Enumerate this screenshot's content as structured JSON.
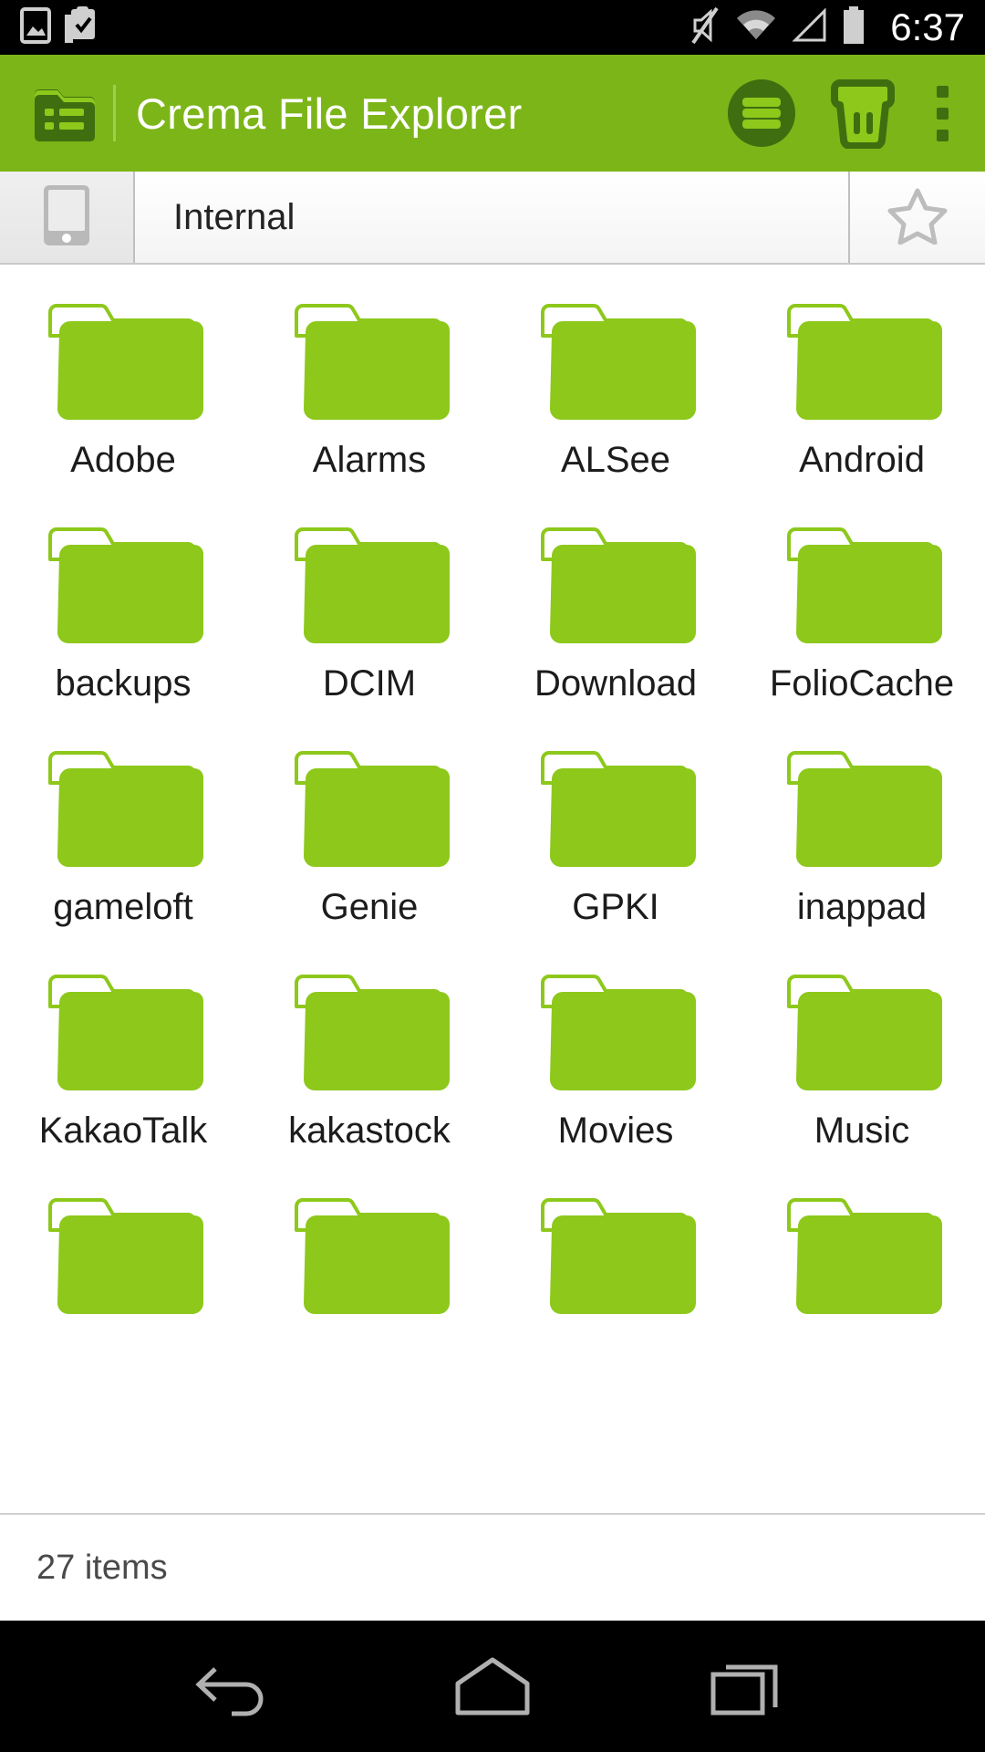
{
  "status_bar": {
    "icons": [
      "image-icon",
      "clipboard-check-icon",
      "mute-icon",
      "wifi-icon",
      "signal-icon",
      "battery-icon"
    ],
    "time": "6:37"
  },
  "action_bar": {
    "app_icon": "folder-list-icon",
    "title": "Crema File Explorer",
    "actions": [
      {
        "name": "list-view-icon",
        "label": "List view"
      },
      {
        "name": "trash-icon",
        "label": "Trash"
      },
      {
        "name": "overflow-menu-icon",
        "label": "More options"
      }
    ],
    "bg_color": "#7cb518",
    "title_color": "#ffffff"
  },
  "path_bar": {
    "device_icon": "tablet-icon",
    "path": "Internal",
    "star_icon": "star-outline-icon"
  },
  "grid": {
    "folder_color": "#8dc81b",
    "items": [
      {
        "name": "Adobe",
        "type": "folder"
      },
      {
        "name": "Alarms",
        "type": "folder"
      },
      {
        "name": "ALSee",
        "type": "folder"
      },
      {
        "name": "Android",
        "type": "folder"
      },
      {
        "name": "backups",
        "type": "folder"
      },
      {
        "name": "DCIM",
        "type": "folder"
      },
      {
        "name": "Download",
        "type": "folder"
      },
      {
        "name": "FolioCache",
        "type": "folder"
      },
      {
        "name": "gameloft",
        "type": "folder"
      },
      {
        "name": "Genie",
        "type": "folder"
      },
      {
        "name": "GPKI",
        "type": "folder"
      },
      {
        "name": "inappad",
        "type": "folder"
      },
      {
        "name": "KakaoTalk",
        "type": "folder"
      },
      {
        "name": "kakastock",
        "type": "folder"
      },
      {
        "name": "Movies",
        "type": "folder"
      },
      {
        "name": "Music",
        "type": "folder"
      },
      {
        "name": "",
        "type": "folder"
      },
      {
        "name": "",
        "type": "folder"
      },
      {
        "name": "",
        "type": "folder"
      },
      {
        "name": "",
        "type": "folder"
      }
    ]
  },
  "footer": {
    "count_text": "27 items"
  },
  "nav_bar": {
    "buttons": [
      {
        "name": "back-button",
        "label": "Back"
      },
      {
        "name": "home-button",
        "label": "Home"
      },
      {
        "name": "recents-button",
        "label": "Recents"
      }
    ]
  }
}
